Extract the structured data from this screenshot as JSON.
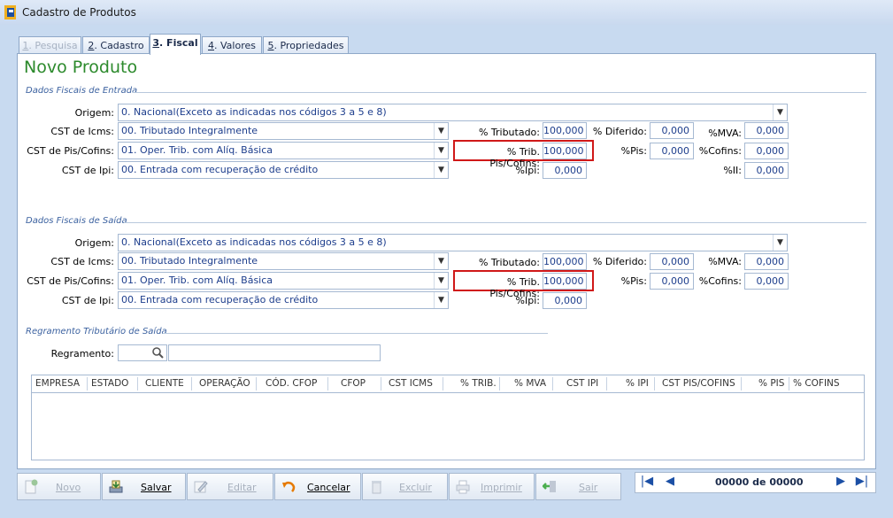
{
  "window": {
    "title": "Cadastro de Produtos"
  },
  "tabs": [
    {
      "num": "1",
      "label": ". Pesquisa"
    },
    {
      "num": "2",
      "label": ". Cadastro"
    },
    {
      "num": "3",
      "label": ". Fiscal"
    },
    {
      "num": "4",
      "label": ". Valores"
    },
    {
      "num": "5",
      "label": ". Propriedades"
    }
  ],
  "page_title": "Novo Produto",
  "entrada": {
    "section_label": "Dados Fiscais de Entrada",
    "origem_label": "Origem:",
    "origem_value": "0. Nacional(Exceto as indicadas nos códigos 3 a 5 e 8)",
    "icms_label": "CST de Icms:",
    "icms_value": "00. Tributado Integralmente",
    "pis_label": "CST de  Pis/Cofins:",
    "pis_value": "01. Oper. Trib. com Alíq. Básica",
    "ipi_label": "CST de Ipi:",
    "ipi_value": "00. Entrada com recuperação de crédito",
    "trib_label": "% Tributado:",
    "trib_value": "100,000",
    "tribpis_label": "% Trib. Pis/Cofins:",
    "tribpis_value": "100,000",
    "pipi_label": "%Ipi:",
    "pipi_value": "0,000",
    "dif_label": "% Diferido:",
    "dif_value": "0,000",
    "ppis_label": "%Pis:",
    "ppis_value": "0,000",
    "mva_label": "%MVA:",
    "mva_value": "0,000",
    "cofins_label": "%Cofins:",
    "cofins_value": "0,000",
    "ii_label": "%II:",
    "ii_value": "0,000"
  },
  "saida": {
    "section_label": "Dados Fiscais de Saída",
    "origem_label": "Origem:",
    "origem_value": "0. Nacional(Exceto as indicadas nos códigos 3 a 5 e 8)",
    "icms_label": "CST de Icms:",
    "icms_value": "00. Tributado Integralmente",
    "pis_label": "CST de  Pis/Cofins:",
    "pis_value": "01. Oper. Trib. com Alíq. Básica",
    "ipi_label": "CST de Ipi:",
    "ipi_value": "00. Entrada com recuperação de crédito",
    "trib_label": "% Tributado:",
    "trib_value": "100,000",
    "tribpis_label": "% Trib. Pis/Cofins:",
    "tribpis_value": "100,000",
    "pipi_label": "%Ipi:",
    "pipi_value": "0,000",
    "dif_label": "% Diferido:",
    "dif_value": "0,000",
    "ppis_label": "%Pis:",
    "ppis_value": "0,000",
    "mva_label": "%MVA:",
    "mva_value": "0,000",
    "cofins_label": "%Cofins:",
    "cofins_value": "0,000"
  },
  "regramento": {
    "section_label": "Regramento Tributário de Saída",
    "label": "Regramento:",
    "code_value": "",
    "desc_value": ""
  },
  "grid": {
    "columns": [
      "EMPRESA",
      "ESTADO",
      "CLIENTE",
      "OPERAÇÃO",
      "CÓD. CFOP",
      "CFOP",
      "CST ICMS",
      "% TRIB.",
      "% MVA",
      "CST IPI",
      "% IPI",
      "CST PIS/COFINS",
      "% PIS",
      "% COFINS"
    ],
    "rows": []
  },
  "buttons": {
    "novo": "Novo",
    "salvar": "Salvar",
    "editar": "Editar",
    "cancelar": "Cancelar",
    "excluir": "Excluir",
    "imprimir": "Imprimir",
    "sair": "Sair"
  },
  "pager": {
    "current": "00000",
    "of": "de",
    "total": "00000"
  },
  "colors": {
    "title_green": "#2c8a2c",
    "value_blue": "#1c3d8c",
    "highlight_red": "#d01818",
    "section_blue": "#3c62a0"
  }
}
